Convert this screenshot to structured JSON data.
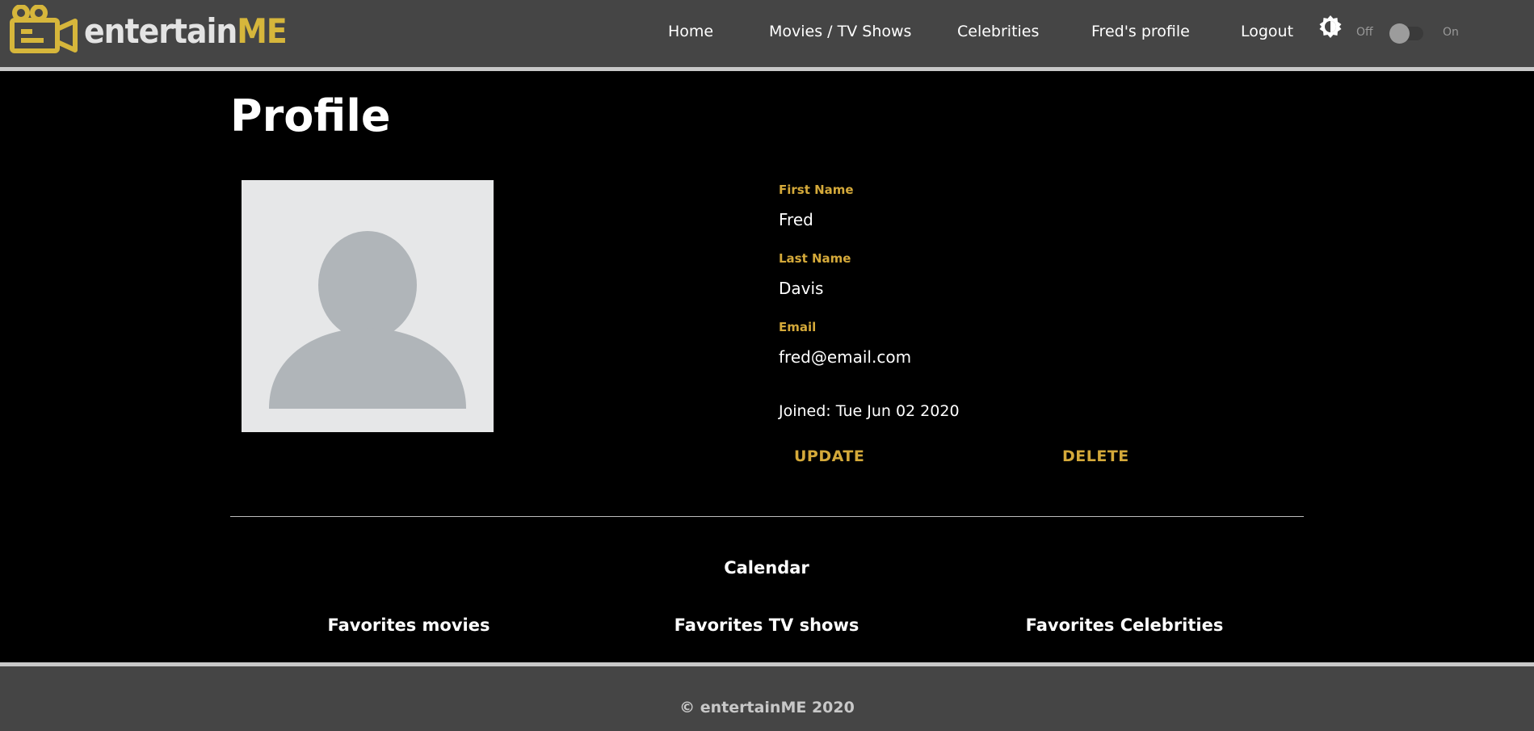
{
  "brand": {
    "name_part1": "entertain",
    "name_part2": "ME",
    "accent_color": "#d6b63b"
  },
  "nav": {
    "items": [
      {
        "label": "Home"
      },
      {
        "label": "Movies / TV Shows"
      },
      {
        "label": "Celebrities"
      },
      {
        "label": "Fred's profile"
      },
      {
        "label": "Logout"
      }
    ],
    "theme_toggle": {
      "icon": "brightness-icon",
      "off_label": "Off",
      "on_label": "On",
      "state": "off"
    }
  },
  "profile": {
    "title": "Profile",
    "avatar_icon": "user-placeholder-icon",
    "fields": [
      {
        "label": "First Name",
        "value": "Fred"
      },
      {
        "label": "Last Name",
        "value": "Davis"
      },
      {
        "label": "Email",
        "value": "fred@email.com"
      }
    ],
    "joined": "Joined: Tue Jun 02 2020",
    "update_label": "UPDATE",
    "delete_label": "DELETE"
  },
  "sections": {
    "calendar": "Calendar",
    "favorites_movies": "Favorites movies",
    "favorites_tv": "Favorites TV shows",
    "favorites_celebrities": "Favorites Celebrities"
  },
  "footer": {
    "text": "© entertainME 2020"
  }
}
